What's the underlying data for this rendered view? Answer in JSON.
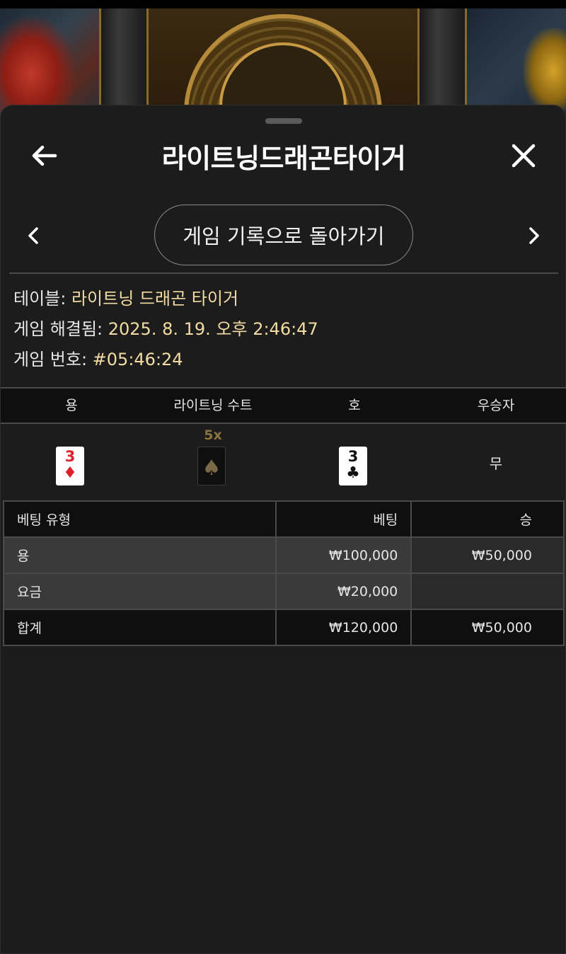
{
  "header": {
    "title": "라이트닝드래곤타이거",
    "back_icon": "arrow-left-icon",
    "close_icon": "close-icon"
  },
  "nav": {
    "history_label": "게임 기록으로 돌아가기",
    "prev_icon": "chevron-left-icon",
    "next_icon": "chevron-right-icon"
  },
  "info": {
    "table_label": "테이블: ",
    "table_value": "라이트닝 드래곤 타이거",
    "resolved_label": "게임 해결됨: ",
    "resolved_value": "2025. 8. 19. 오후 2:46:47",
    "number_label": "게임 번호: ",
    "number_value": "#05:46:24"
  },
  "result": {
    "headers": [
      "용",
      "라이트닝 수트",
      "호",
      "우승자"
    ],
    "dragon_card": {
      "rank": "3",
      "suit": "♦",
      "color": "#e0202a"
    },
    "lightning_suit": {
      "multiplier": "5x",
      "suit": "♠"
    },
    "tiger_card": {
      "rank": "3",
      "suit": "♣",
      "color": "#111111"
    },
    "winner": "무"
  },
  "bets": {
    "headers": [
      "베팅 유형",
      "베팅",
      "승"
    ],
    "rows": [
      {
        "type": "용",
        "bet": "₩100,000",
        "win": "₩50,000"
      },
      {
        "type": "요금",
        "bet": "₩20,000",
        "win": ""
      },
      {
        "type": "합계",
        "bet": "₩120,000",
        "win": "₩50,000"
      }
    ]
  },
  "colors": {
    "panel_bg": "#1c1c1c",
    "info_value": "#f3dca3",
    "multiplier": "#8c7340"
  }
}
